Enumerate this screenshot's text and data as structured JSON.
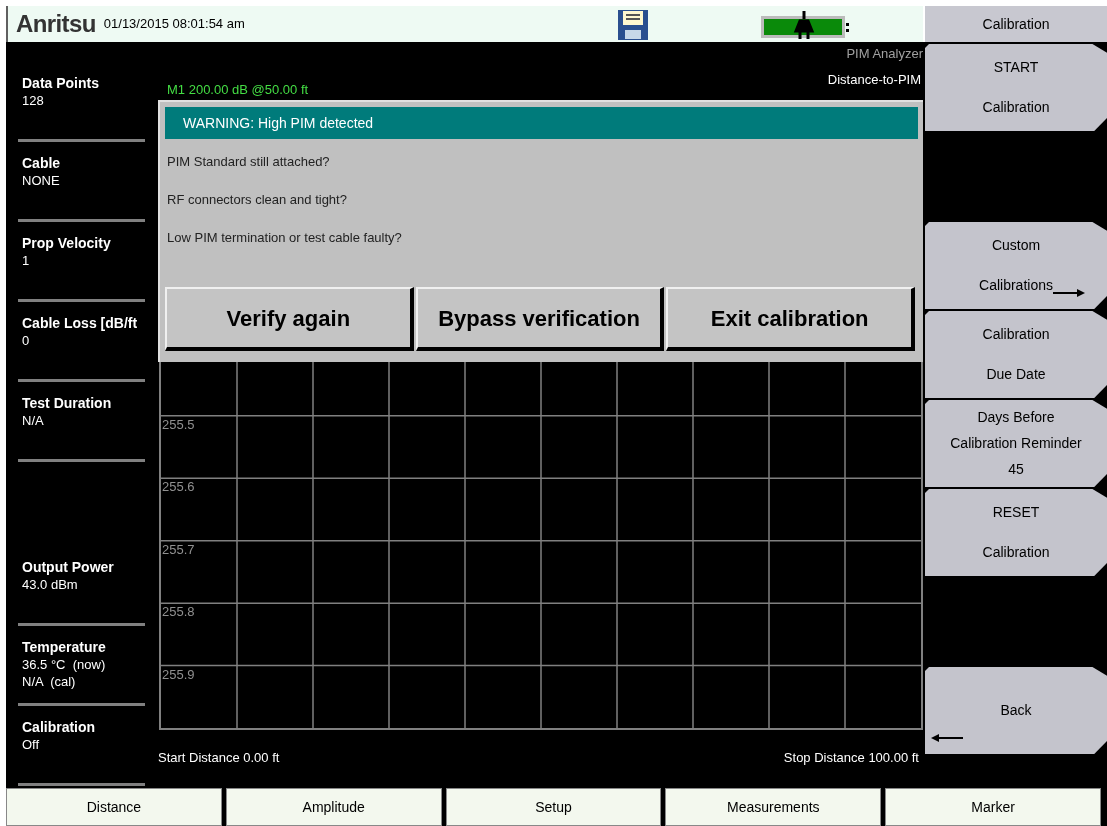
{
  "header": {
    "logo": "Anritsu",
    "datetime": "01/13/2015 08:01:54 am",
    "menu_title": "Calibration"
  },
  "params_top": [
    {
      "label": "Data Points",
      "lines": [
        "128"
      ]
    },
    {
      "label": "Cable",
      "lines": [
        "NONE"
      ]
    },
    {
      "label": "Prop Velocity",
      "lines": [
        "1"
      ]
    },
    {
      "label": "Cable Loss [dB/ft",
      "lines": [
        "0"
      ]
    },
    {
      "label": "Test Duration",
      "lines": [
        "N/A"
      ]
    }
  ],
  "params_bottom": [
    {
      "label": "Output Power",
      "lines": [
        "43.0 dBm"
      ]
    },
    {
      "label": "Temperature",
      "lines": [
        "36.5 °C  (now)",
        "N/A  (cal)"
      ]
    },
    {
      "label": "Calibration",
      "lines": [
        "Off"
      ]
    }
  ],
  "graph": {
    "mode": "PIM Analyzer",
    "measurement": "Distance-to-PIM",
    "marker": "M1 200.00 dB @50.00 ft",
    "y_labels": [
      "255.5",
      "255.6",
      "255.7",
      "255.8",
      "255.9"
    ],
    "start": "Start Distance 0.00 ft",
    "stop": "Stop Distance 100.00 ft"
  },
  "dialog": {
    "title": "WARNING: High PIM detected",
    "messages": [
      "PIM Standard still attached?",
      "RF connectors clean and tight?",
      "Low PIM termination or test cable faulty?"
    ],
    "buttons": [
      "Verify again",
      "Bypass verification",
      "Exit calibration"
    ]
  },
  "softkeys": [
    {
      "kind": "key",
      "lines": [
        "START",
        "Calibration"
      ]
    },
    {
      "kind": "blank"
    },
    {
      "kind": "submenu",
      "lines": [
        "Custom",
        "Calibrations"
      ]
    },
    {
      "kind": "key",
      "lines": [
        "Calibration",
        "Due Date"
      ]
    },
    {
      "kind": "key",
      "lines": [
        "Days Before",
        "Calibration Reminder",
        "45"
      ]
    },
    {
      "kind": "key",
      "lines": [
        "RESET",
        "Calibration"
      ]
    },
    {
      "kind": "blank"
    },
    {
      "kind": "back",
      "lines": [
        "Back"
      ]
    }
  ],
  "tabs": [
    "Distance",
    "Amplitude",
    "Setup",
    "Measurements",
    "Marker"
  ]
}
